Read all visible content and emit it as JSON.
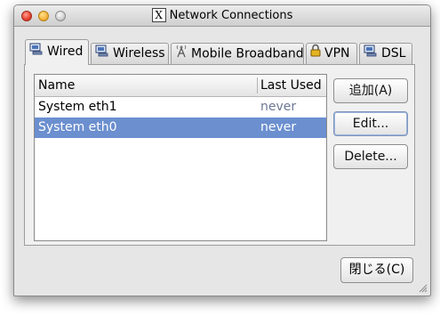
{
  "window": {
    "title": "Network Connections"
  },
  "tabs": [
    {
      "label": "Wired",
      "icon": "wired-icon",
      "active": true
    },
    {
      "label": "Wireless",
      "icon": "wireless-icon",
      "active": false
    },
    {
      "label": "Mobile Broadband",
      "icon": "antenna-icon",
      "active": false
    },
    {
      "label": "VPN",
      "icon": "lock-icon",
      "active": false
    },
    {
      "label": "DSL",
      "icon": "dsl-icon",
      "active": false
    }
  ],
  "list": {
    "columns": {
      "name": "Name",
      "last_used": "Last Used"
    },
    "rows": [
      {
        "name": "System eth1",
        "last_used": "never",
        "selected": false
      },
      {
        "name": "System eth0",
        "last_used": "never",
        "selected": true
      }
    ]
  },
  "buttons": {
    "add": "追加(A)",
    "edit": "Edit...",
    "delete": "Delete...",
    "close": "閉じる(C)"
  },
  "colors": {
    "selection": "#6b8fcf",
    "secondary_text": "#6b7794"
  }
}
